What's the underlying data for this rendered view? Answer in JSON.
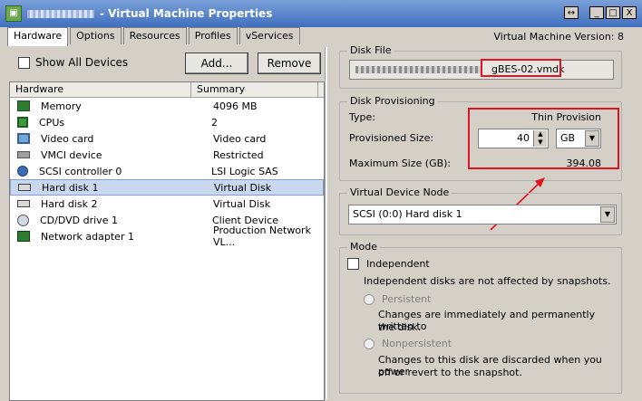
{
  "window": {
    "title": "- Virtual Machine Properties",
    "buttons": {
      "restore": "↔",
      "minimize": "_",
      "maximize": "□",
      "close": "X"
    }
  },
  "tabs": [
    "Hardware",
    "Options",
    "Resources",
    "Profiles",
    "vServices"
  ],
  "vm_version": "Virtual Machine Version: 8",
  "left": {
    "show_all_label": "Show All Devices",
    "add_label": "Add...",
    "remove_label": "Remove",
    "columns": [
      "Hardware",
      "Summary"
    ],
    "rows": [
      {
        "name": "Memory",
        "summary": "4096 MB",
        "icon": "memory-icon"
      },
      {
        "name": "CPUs",
        "summary": "2",
        "icon": "cpu-icon"
      },
      {
        "name": "Video card",
        "summary": "Video card",
        "icon": "monitor-icon"
      },
      {
        "name": "VMCI device",
        "summary": "Restricted",
        "icon": "vmci-icon"
      },
      {
        "name": "SCSI controller 0",
        "summary": "LSI Logic SAS",
        "icon": "scsi-icon"
      },
      {
        "name": "Hard disk 1",
        "summary": "Virtual Disk",
        "icon": "harddisk-icon"
      },
      {
        "name": "Hard disk 2",
        "summary": "Virtual Disk",
        "icon": "harddisk-icon"
      },
      {
        "name": "CD/DVD drive 1",
        "summary": "Client Device",
        "icon": "cdrom-icon"
      },
      {
        "name": "Network adapter 1",
        "summary": "Production Network VL...",
        "icon": "network-icon"
      }
    ],
    "selected_index": 5
  },
  "disk_file": {
    "legend": "Disk File",
    "value_suffix": "gBES-02.vmdk"
  },
  "provisioning": {
    "legend": "Disk Provisioning",
    "type_label": "Type:",
    "type_value": "Thin Provision",
    "size_label": "Provisioned Size:",
    "size_value": "40",
    "unit_value": "GB",
    "max_label": "Maximum Size (GB):",
    "max_value": "394.08"
  },
  "device_node": {
    "legend": "Virtual Device Node",
    "value": "SCSI (0:0) Hard disk 1"
  },
  "mode": {
    "legend": "Mode",
    "independent_label": "Independent",
    "independent_desc": "Independent disks are not affected by snapshots.",
    "persistent_label": "Persistent",
    "persistent_desc_1": "Changes are immediately and permanently written to",
    "persistent_desc_2": "the disk.",
    "nonpersistent_label": "Nonpersistent",
    "nonpersistent_desc_1": "Changes to this disk are discarded when you power",
    "nonpersistent_desc_2": "off or revert to the snapshot."
  },
  "colors": {
    "annotation": "#e0141e",
    "selection": "#c9d8ef",
    "titlebar": "#3f6fbe"
  }
}
